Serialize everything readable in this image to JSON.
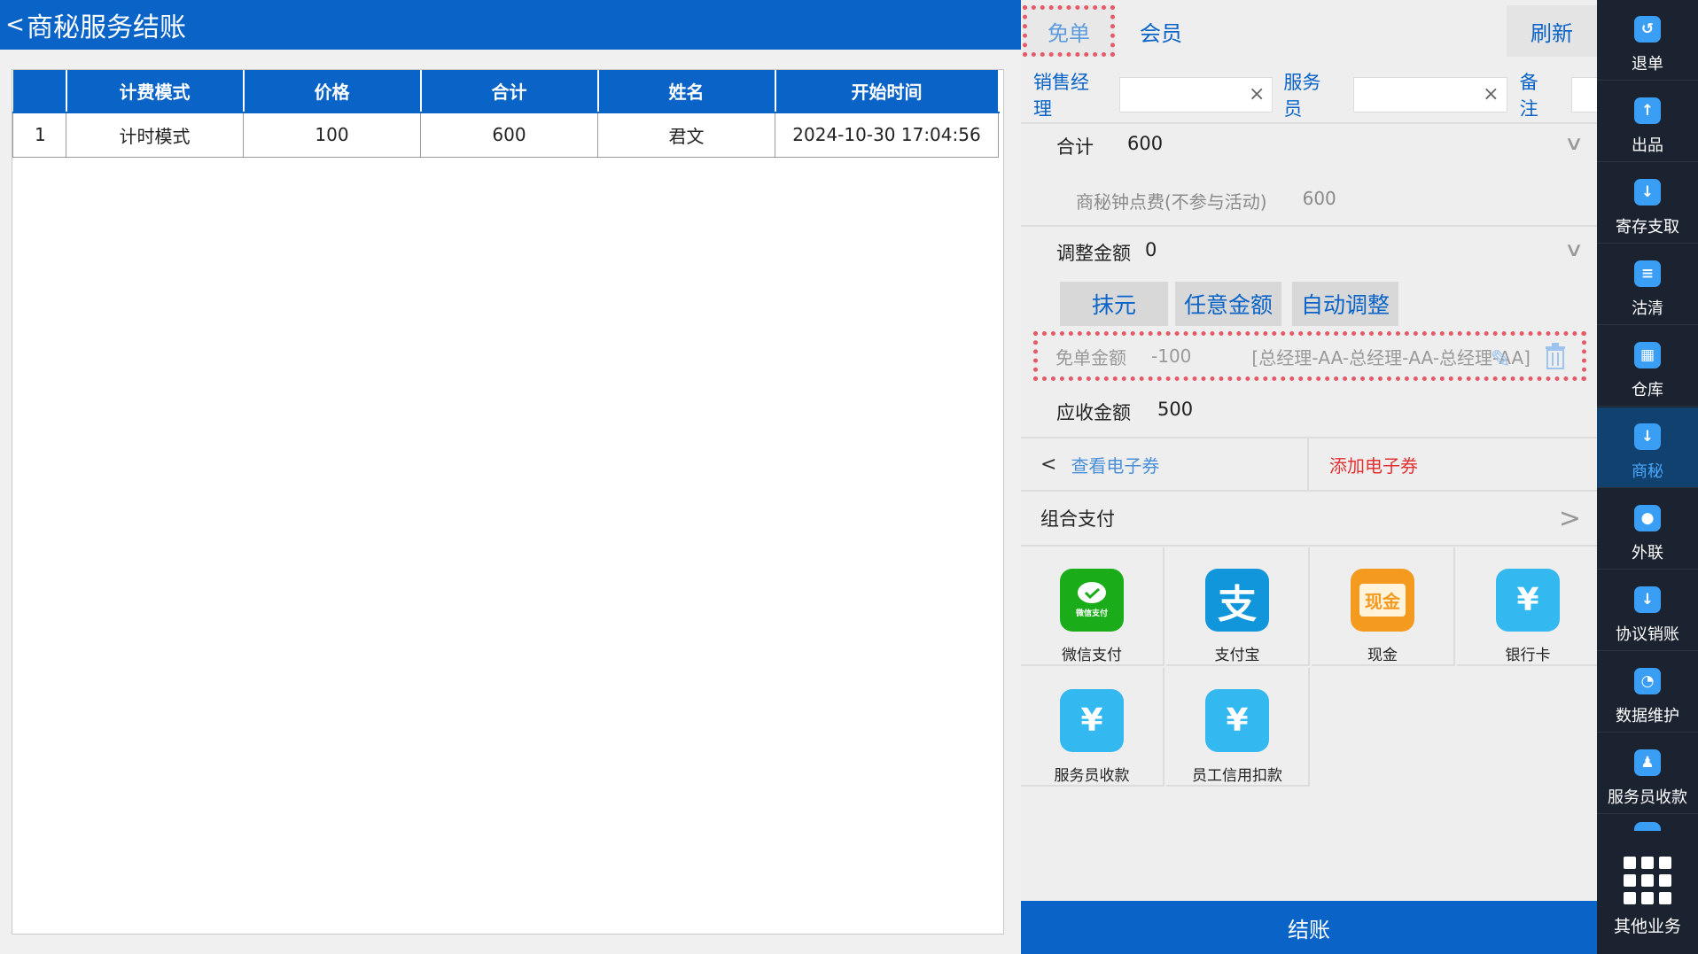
{
  "header": {
    "back_glyph": "<",
    "title": "商秘服务结账"
  },
  "table": {
    "columns": [
      "",
      "计费模式",
      "价格",
      "合计",
      "姓名",
      "开始时间"
    ],
    "rows": [
      [
        "1",
        "计时模式",
        "100",
        "600",
        "君文",
        "2024-10-30 17:04:56"
      ]
    ]
  },
  "tabs": {
    "free": "免单",
    "member": "会员",
    "refresh": "刷新"
  },
  "staff": {
    "sales_manager_label": "销售经理",
    "sales_manager_value": "",
    "waiter_label": "服务员",
    "waiter_value": "",
    "remark_label": "备注",
    "clear_glyph": "×"
  },
  "summary": {
    "total_label": "合计",
    "total_value": "600",
    "fee_label": "商秘钟点费(不参与活动)",
    "fee_value": "600",
    "adjust_label": "调整金额",
    "adjust_value": "0",
    "adjust_buttons": [
      "抹元",
      "任意金额",
      "自动调整"
    ],
    "free_label": "免单金额",
    "free_value": "-100",
    "free_detail": "[总经理-AA-总经理-AA-总经理-AA]",
    "receivable_label": "应收金额",
    "receivable_value": "500"
  },
  "coupons": {
    "view": "查看电子券",
    "add": "添加电子券"
  },
  "combo_pay": {
    "label": "组合支付"
  },
  "payments": [
    {
      "label": "微信支付",
      "icon": "wechat-pay-icon",
      "color": "#1aad19",
      "glyph": "微信支付"
    },
    {
      "label": "支付宝",
      "icon": "alipay-icon",
      "color": "#1296db",
      "glyph": "支"
    },
    {
      "label": "现金",
      "icon": "cash-icon",
      "color": "#f39a1f",
      "glyph": "现金"
    },
    {
      "label": "银行卡",
      "icon": "bank-card-icon",
      "color": "#34b8f0",
      "glyph": "¥"
    },
    {
      "label": "服务员收款",
      "icon": "waiter-payment-icon",
      "color": "#34b8f0",
      "glyph": "¥"
    },
    {
      "label": "员工信用扣款",
      "icon": "staff-credit-icon",
      "color": "#34b8f0",
      "glyph": "¥"
    }
  ],
  "checkout": "结账",
  "sidebar": {
    "items": [
      {
        "label": "退单",
        "icon": "refund-icon"
      },
      {
        "label": "出品",
        "icon": "serve-icon"
      },
      {
        "label": "寄存支取",
        "icon": "storage-icon"
      },
      {
        "label": "沽清",
        "icon": "soldout-icon"
      },
      {
        "label": "仓库",
        "icon": "warehouse-icon"
      },
      {
        "label": "商秘",
        "icon": "secretary-icon",
        "active": true
      },
      {
        "label": "外联",
        "icon": "outreach-icon"
      },
      {
        "label": "协议销账",
        "icon": "agreement-icon"
      },
      {
        "label": "数据维护",
        "icon": "data-icon"
      },
      {
        "label": "服务员收款",
        "icon": "waiter-collect-icon"
      }
    ],
    "other": "其他业务"
  },
  "colors": {
    "brand": "#0a63c7",
    "highlight_border": "#e55a66",
    "sidebar_bg": "#1b2230",
    "danger": "#e23232"
  }
}
